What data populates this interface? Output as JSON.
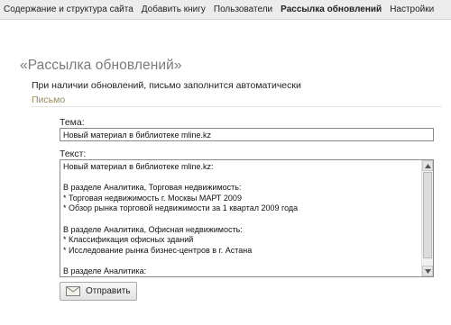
{
  "nav": {
    "items": [
      {
        "label": "Содержание и структура сайта",
        "active": false
      },
      {
        "label": "Добавить книгу",
        "active": false
      },
      {
        "label": "Пользователи",
        "active": false
      },
      {
        "label": "Рассылка обновлений",
        "active": true
      },
      {
        "label": "Настройки",
        "active": false
      }
    ]
  },
  "page": {
    "title": "«Рассылка обновлений»",
    "subtitle": "При наличии обновлений, письмо заполнится автоматически",
    "section_link": "Письмо"
  },
  "form": {
    "subject_label": "Тема:",
    "subject_value": "Новый материал в библиотеке mline.kz",
    "body_label": "Текст:",
    "body_value": "Новый материал в библиотеке mline.kz:\n\nВ разделе Аналитика, Торговая недвижимость:\n* Торговая недвижимость г. Москвы МАРТ 2009\n* Обзор рынка торговой недвижимости за 1 квартал 2009 года\n\nВ разделе Аналитика, Офисная недвижимость:\n* Классификация офисных зданий\n* Исследование рынка бизнес-центров в г. Астана\n\nВ разделе Аналитика:",
    "send_label": "Отправить"
  },
  "icons": {
    "send": "mail-envelope-icon",
    "scroll_up": "arrow-up-icon",
    "scroll_down": "arrow-down-icon"
  },
  "colors": {
    "nav_bg": "#ececec",
    "title": "#7a7a7a",
    "section_link": "#9a8a5a"
  }
}
